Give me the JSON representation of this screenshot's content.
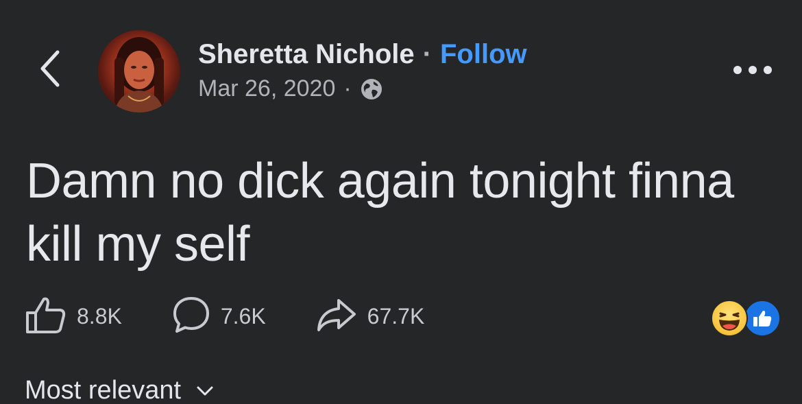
{
  "header": {
    "back_icon": "chevron-left-icon",
    "author_name": "Sheretta Nichole",
    "separator": "·",
    "follow_label": "Follow",
    "date": "Mar 26, 2020",
    "meta_separator": "·",
    "audience_icon": "globe-icon",
    "more_icon": "more-horizontal-icon"
  },
  "post": {
    "text": "Damn no dick again tonight finna kill my self"
  },
  "actions": {
    "likes": "8.8K",
    "comments": "7.6K",
    "shares": "67.7K",
    "reactions": [
      "haha-icon",
      "like-icon"
    ]
  },
  "sort": {
    "label": "Most relevant",
    "icon": "chevron-down-icon"
  },
  "colors": {
    "background": "#252628",
    "accent": "#4599ff",
    "text_primary": "#e4e6eb",
    "text_secondary": "#b0b3b8",
    "like_blue": "#1b74e4"
  }
}
